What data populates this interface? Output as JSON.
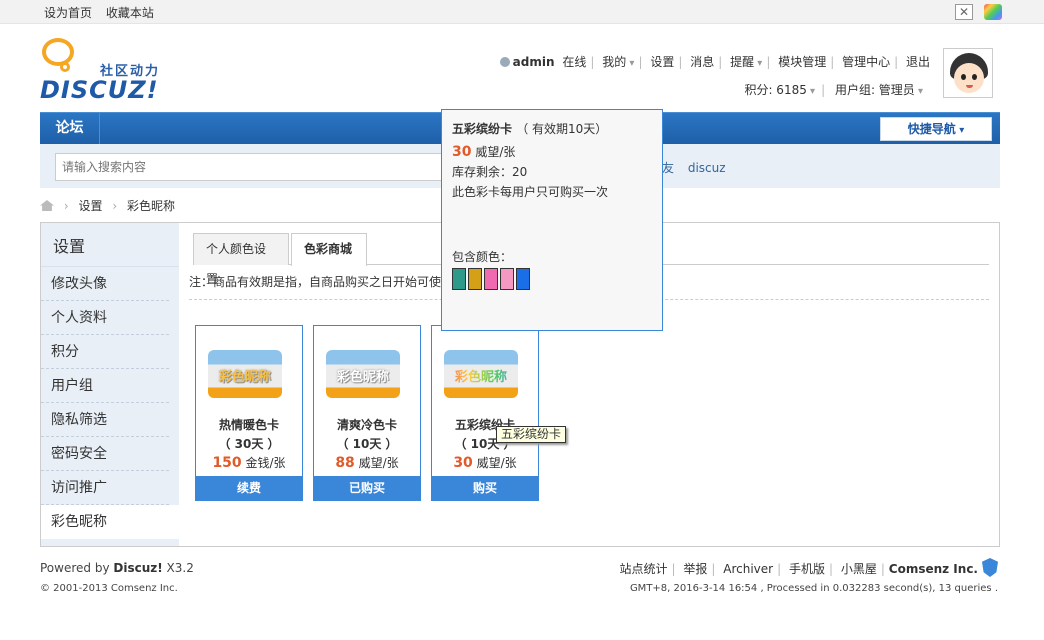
{
  "topbar": {
    "set_home": "设为首页",
    "bookmark": "收藏本站"
  },
  "logo": {
    "slogan": "社区动力",
    "word": "DISCUZ!"
  },
  "user_menu": {
    "username": "admin",
    "online": "在线",
    "mine": "我的",
    "settings": "设置",
    "messages": "消息",
    "reminders": "提醒",
    "module_manage": "模块管理",
    "admin_center": "管理中心",
    "logout": "退出",
    "points": "积分: 6185",
    "user_group": "用户组: 管理员"
  },
  "nav": {
    "forum": "论坛",
    "quick_nav": "快捷导航"
  },
  "search": {
    "placeholder": "请输入搜索内容",
    "hot1": "交友",
    "hot2": "discuz"
  },
  "breadcrumb": {
    "settings": "设置",
    "current": "彩色昵称"
  },
  "sidebar": {
    "title": "设置",
    "items": [
      {
        "label": "修改头像"
      },
      {
        "label": "个人资料"
      },
      {
        "label": "积分"
      },
      {
        "label": "用户组"
      },
      {
        "label": "隐私筛选"
      },
      {
        "label": "密码安全"
      },
      {
        "label": "访问推广"
      },
      {
        "label": "彩色昵称"
      }
    ]
  },
  "tabs": {
    "personal_color": "个人颜色设置",
    "color_shop": "色彩商城"
  },
  "note": "注：商品有效期是指，自商品购买之日开始可使",
  "cards": [
    {
      "image_label": "彩色昵称",
      "name": "热情暖色卡",
      "days": "（ 30天 ）",
      "price": "150",
      "unit": "金钱/张",
      "button": "续费"
    },
    {
      "image_label": "彩色昵称",
      "name": "清爽冷色卡",
      "days": "（ 10天 ）",
      "price": "88",
      "unit": "威望/张",
      "button": "已购买"
    },
    {
      "image_label": "彩色昵称",
      "name": "五彩缤纷卡",
      "days": "（ 10天 ）",
      "price": "30",
      "unit": "威望/张",
      "button": "购买"
    }
  ],
  "popup": {
    "title": "五彩缤纷卡",
    "validity": "（ 有效期10天）",
    "price": "30",
    "unit": "威望/张",
    "stock": "库存剩余：20",
    "limit": "此色彩卡每用户只可购买一次",
    "colors_label": "包含颜色：",
    "colors": [
      "#2e9a8a",
      "#d4a017",
      "#f06ab0",
      "#f49ac2",
      "#1a6fe8"
    ]
  },
  "tooltip": "五彩缤纷卡",
  "footer": {
    "powered_prefix": "Powered by ",
    "powered_brand": "Discuz!",
    "powered_version": " X3.2",
    "copyright": "© 2001-2013 Comsenz Inc.",
    "links": [
      "站点统计",
      "举报",
      "Archiver",
      "手机版",
      "小黑屋"
    ],
    "company": "Comsenz Inc.",
    "stats": "GMT+8, 2016-3-14 16:54 , Processed in 0.032283 second(s), 13 queries ."
  }
}
